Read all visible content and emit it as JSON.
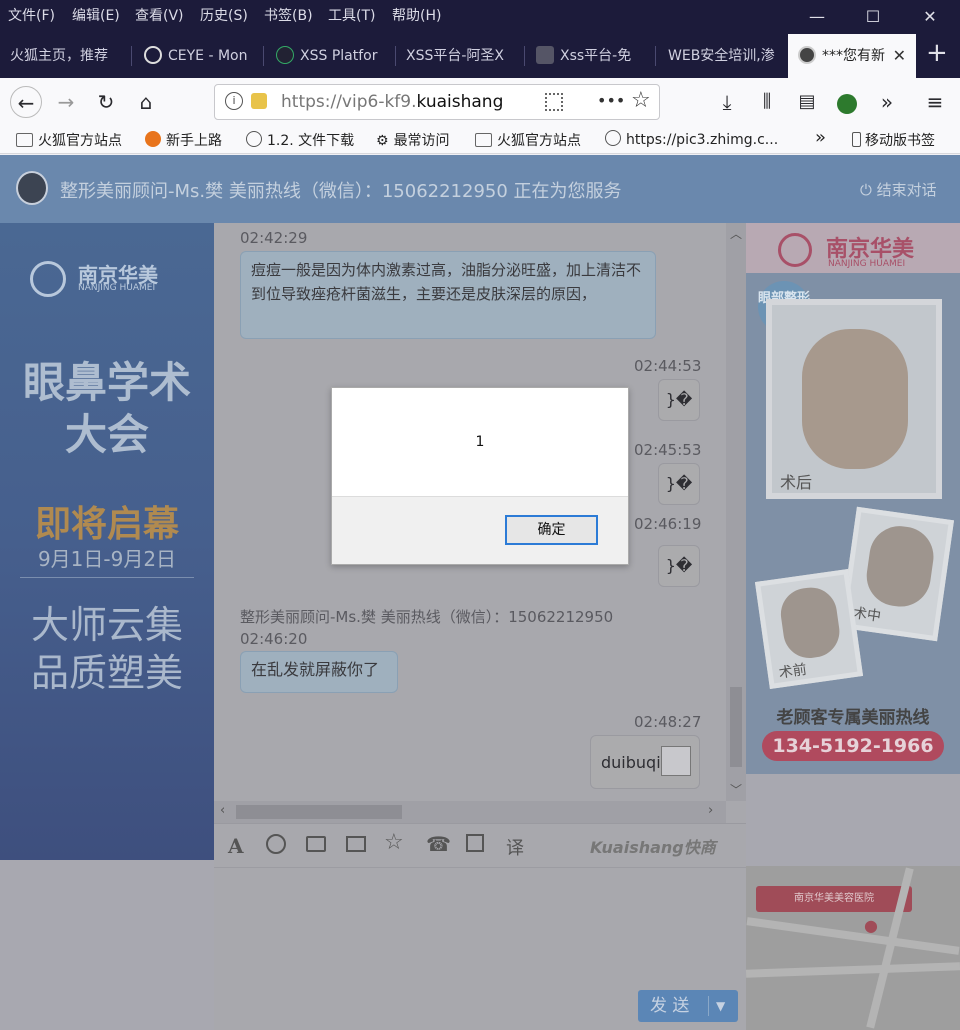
{
  "menubar": {
    "items": [
      "文件(F)",
      "编辑(E)",
      "查看(V)",
      "历史(S)",
      "书签(B)",
      "工具(T)",
      "帮助(H)"
    ],
    "minimize": "—",
    "maximize": "☐",
    "close": "✕"
  },
  "tabs": [
    {
      "label": "火狐主页，推荐"
    },
    {
      "label": "CEYE - Mon"
    },
    {
      "label": "XSS Platfor"
    },
    {
      "label": "XSS平台-阿圣X"
    },
    {
      "label": "Xss平台-免"
    },
    {
      "label": "WEB安全培训,渗"
    },
    {
      "label": "***您有新",
      "active": true
    }
  ],
  "tab_close": "✕",
  "new_tab": "+",
  "navbar": {
    "url_prefix": "https://vip6-kf9.",
    "url_domain": "kuaishang",
    "more": "•••"
  },
  "bookmarks": {
    "items": [
      "火狐官方站点",
      "新手上路",
      "1.2. 文件下载",
      "最常访问",
      "火狐官方站点",
      "https://pic3.zhimg.c..."
    ],
    "overflow": "»",
    "mobile": "移动版书签"
  },
  "chat": {
    "header_title": "整形美丽顾问-Ms.樊 美丽热线（微信）：15062212950 正在为您服务",
    "end_chat": "结束对话",
    "messages": [
      {
        "time": "02:42:29",
        "text": "痘痘一般是因为体内激素过高，油脂分泌旺盛，加上清洁不到位导致痤疮杆菌滋生，主要还是皮肤深层的原因，"
      },
      {
        "time": "02:44:53",
        "text": "}�"
      },
      {
        "time": "02:45:53",
        "text": "}�"
      },
      {
        "time": "02:46:19",
        "text": "}�"
      },
      {
        "sender": "整形美丽顾问-Ms.樊 美丽热线（微信）：15062212950",
        "time": "02:46:20",
        "text": "在乱发就屏蔽你了"
      },
      {
        "time": "02:48:27",
        "text": "duibuqi"
      }
    ],
    "send_button": "发 送",
    "brand": "Kuaishang快商",
    "tool_translate": "译"
  },
  "left_ad": {
    "brand": "南京华美",
    "brand_en": "NANJING HUAMEI",
    "headline1": "眼鼻学术",
    "headline2": "大会",
    "sub1": "即将启幕",
    "dates": "9月1日-9月2日",
    "slogan1": "大师云集",
    "slogan2": "品质塑美"
  },
  "right_ad": {
    "brand": "南京华美",
    "brand_en": "NANJING HUAMEI",
    "badge": "眼部整形",
    "label_after": "术后",
    "label_mid": "术中",
    "label_before": "术前",
    "tagline": "老顾客专属美丽热线",
    "phone": "134-5192-1966"
  },
  "map": {
    "title": "南京华美美容医院"
  },
  "dialog": {
    "message": "1",
    "ok_label": "确定"
  },
  "colors": {
    "titlebar": "#1c1b3a",
    "dim_overlay": "#a8a8ad",
    "dialog_button_border": "#2c7bd6",
    "send_button": "#5b86b6",
    "phone_pill": "#b04a5e"
  }
}
